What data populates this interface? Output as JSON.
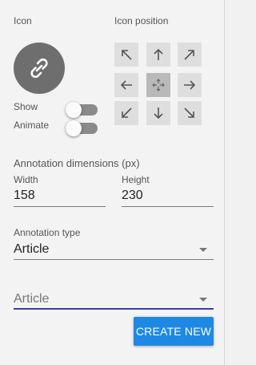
{
  "icon_section": {
    "label": "Icon",
    "icon_name": "link-icon"
  },
  "position_section": {
    "label": "Icon position",
    "buttons": [
      {
        "icon": "arrow-up-left-icon"
      },
      {
        "icon": "arrow-up-icon"
      },
      {
        "icon": "arrow-up-right-icon"
      },
      {
        "icon": "arrow-left-icon"
      },
      {
        "icon": "center-move-icon",
        "selected": true
      },
      {
        "icon": "arrow-right-icon"
      },
      {
        "icon": "arrow-down-left-icon"
      },
      {
        "icon": "arrow-down-icon"
      },
      {
        "icon": "arrow-down-right-icon"
      }
    ]
  },
  "toggles": {
    "show_label": "Show",
    "animate_label": "Animate"
  },
  "dimensions": {
    "title": "Annotation dimensions (px)",
    "width_label": "Width",
    "width_value": "158",
    "height_label": "Height",
    "height_value": "230"
  },
  "annotation_type": {
    "label": "Annotation type",
    "value": "Article"
  },
  "select_field": {
    "value": "Article",
    "underline_color": "#3f3f9f"
  },
  "create_button": {
    "label": "CREATE NEW",
    "color": "#1e88e5"
  }
}
